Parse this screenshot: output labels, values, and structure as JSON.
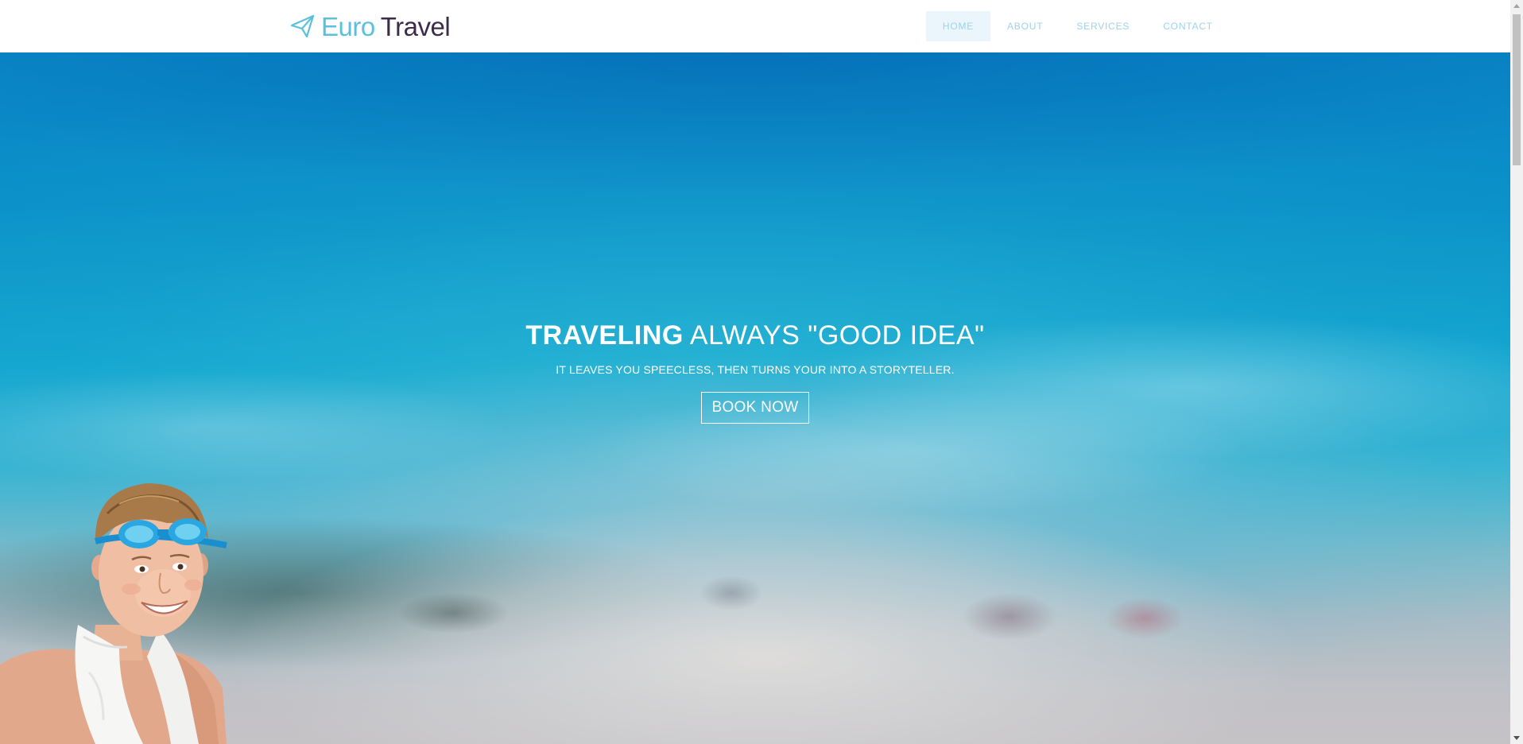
{
  "brand": {
    "icon": "paper-plane-icon",
    "word1": "Euro",
    "word2": "Travel",
    "word1_color": "#5bc0de",
    "word2_color": "#3d2b4a"
  },
  "nav": {
    "items": [
      {
        "label": "HOME",
        "active": true
      },
      {
        "label": "ABOUT",
        "active": false
      },
      {
        "label": "SERVICES",
        "active": false
      },
      {
        "label": "CONTACT",
        "active": false
      }
    ],
    "text_color": "#9cd4e8",
    "active_bg": "#eaf6fc"
  },
  "hero": {
    "title_strong": "TRAVELING",
    "title_rest": "ALWAYS \"GOOD IDEA\"",
    "subtitle": "IT LEAVES YOU SPEECLESS, THEN TURNS YOUR INTO A STORYTELLER.",
    "cta_label": "BOOK NOW",
    "background": "blurred-beach-photo",
    "foreground": "boy-with-goggles-and-towel-photo"
  }
}
